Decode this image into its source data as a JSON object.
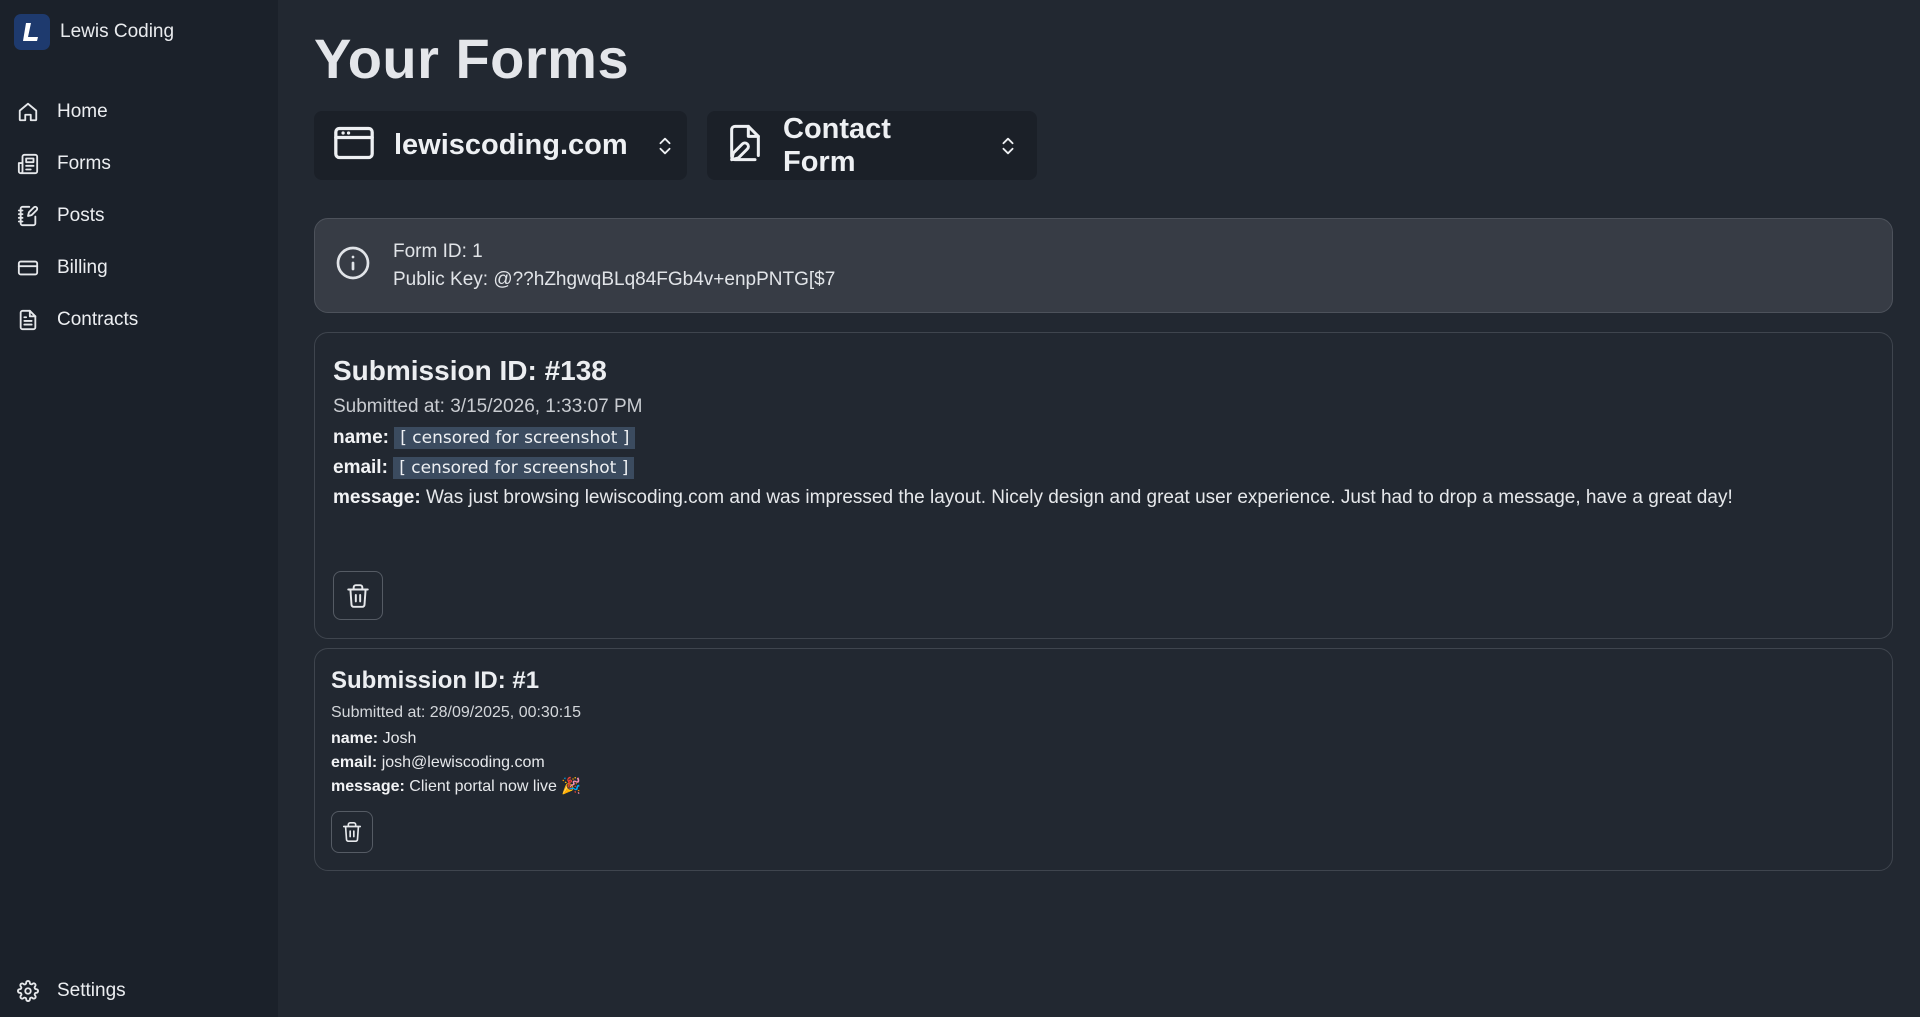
{
  "app": {
    "brand_name": "Lewis Coding",
    "accent_color": "#1e3a6e"
  },
  "sidebar": {
    "items": [
      {
        "label": "Home",
        "icon": "home-icon"
      },
      {
        "label": "Forms",
        "icon": "newspaper-icon"
      },
      {
        "label": "Posts",
        "icon": "notebook-pen-icon"
      },
      {
        "label": "Billing",
        "icon": "credit-card-icon"
      },
      {
        "label": "Contracts",
        "icon": "file-text-icon"
      }
    ],
    "settings_label": "Settings"
  },
  "main": {
    "title": "Your Forms",
    "site_selector": {
      "value": "lewiscoding.com",
      "icon": "browser-window-icon"
    },
    "form_selector": {
      "value": "Contact Form",
      "icon": "file-signature-icon"
    },
    "info": {
      "form_id": "Form ID: 1",
      "public_key": "Public Key: @??hZhgwqBLq84FGb4v+enpPNTG[$7"
    },
    "submissions": [
      {
        "title": "Submission ID: #138",
        "submitted_at": "Submitted at: 3/15/2026, 1:33:07 PM",
        "name_label": "name:",
        "name_value": "[ censored for screenshot ]",
        "email_label": "email:",
        "email_value": "[ censored for screenshot ]",
        "message_label": "message:",
        "message_value": "Was just browsing lewiscoding.com and was impressed the layout. Nicely design and great user experience. Just had to drop a message, have a great day!"
      },
      {
        "title": "Submission ID: #1",
        "submitted_at": "Submitted at: 28/09/2025, 00:30:15",
        "name_label": "name:",
        "name_value": "Josh",
        "email_label": "email:",
        "email_value": "josh@lewiscoding.com",
        "message_label": "message:",
        "message_value": "Client portal now live 🎉"
      }
    ]
  }
}
